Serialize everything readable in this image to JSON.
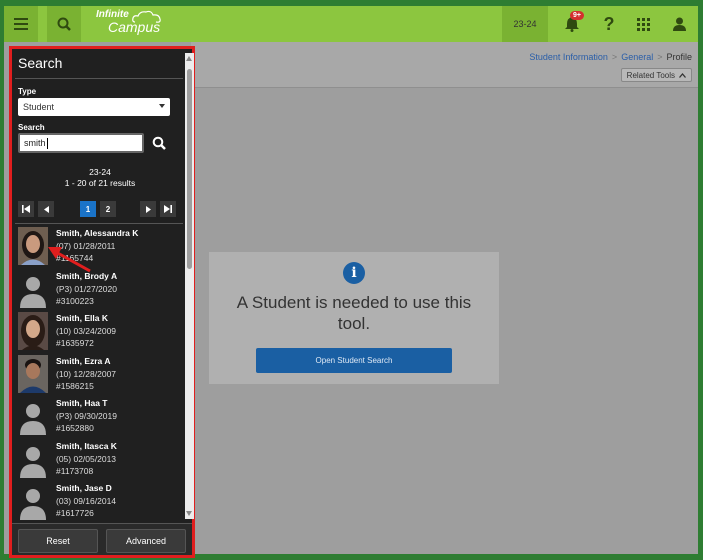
{
  "topbar": {
    "logo_line1": "Infinite",
    "logo_line2": "Campus",
    "school_year": "23-24",
    "notification_count": "9+",
    "help_label": "?"
  },
  "breadcrumb": {
    "items": [
      "Student Information",
      "General",
      "Profile"
    ],
    "related_tools": "Related Tools"
  },
  "notice": {
    "icon": "i",
    "message": "A Student is needed to use this tool.",
    "button": "Open Student Search"
  },
  "search_panel": {
    "title": "Search",
    "type_label": "Type",
    "type_value": "Student",
    "search_label": "Search",
    "search_value": "smith",
    "results_year": "23-24",
    "results_summary": "1 - 20 of 21 results",
    "pages": [
      "1",
      "2"
    ],
    "current_page": "1",
    "students": [
      {
        "name": "Smith, Alessandra K",
        "grade_dob": "(07) 01/28/2011",
        "id": "#1165744"
      },
      {
        "name": "Smith, Brody A",
        "grade_dob": "(P3) 01/27/2020",
        "id": "#3100223"
      },
      {
        "name": "Smith, Ella K",
        "grade_dob": "(10) 03/24/2009",
        "id": "#1635972"
      },
      {
        "name": "Smith, Ezra A",
        "grade_dob": "(10) 12/28/2007",
        "id": "#1586215"
      },
      {
        "name": "Smith, Haa T",
        "grade_dob": "(P3) 09/30/2019",
        "id": "#1652880"
      },
      {
        "name": "Smith, Itasca K",
        "grade_dob": "(05) 02/05/2013",
        "id": "#1173708"
      },
      {
        "name": "Smith, Jase D",
        "grade_dob": "(03) 09/16/2014",
        "id": "#1617726"
      }
    ],
    "reset_button": "Reset",
    "advanced_button": "Advanced"
  },
  "colors": {
    "topbar": "#8cc63f",
    "panel_bg": "#202020",
    "highlight_border": "#e01e1e",
    "accent_blue": "#1a5fa3"
  }
}
